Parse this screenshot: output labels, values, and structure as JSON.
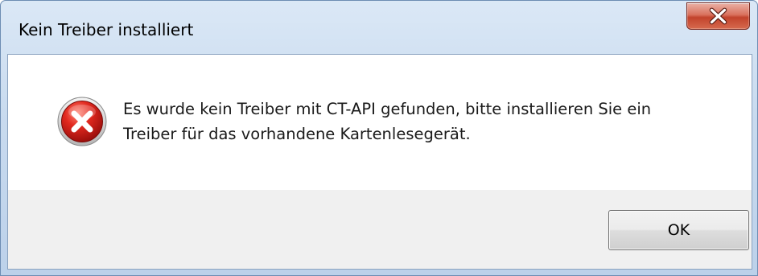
{
  "dialog": {
    "title": "Kein Treiber installiert",
    "message": "Es wurde kein Treiber mit CT-API gefunden, bitte installieren Sie ein\nTreiber für das vorhandene Kartenlesegerät.",
    "icon": "error-icon",
    "ok_label": "OK"
  },
  "colors": {
    "title_bar": "#c9dbef",
    "close_button": "#c2432c",
    "error_icon": "#d41f1f",
    "button_bar": "#f0f0f0"
  }
}
